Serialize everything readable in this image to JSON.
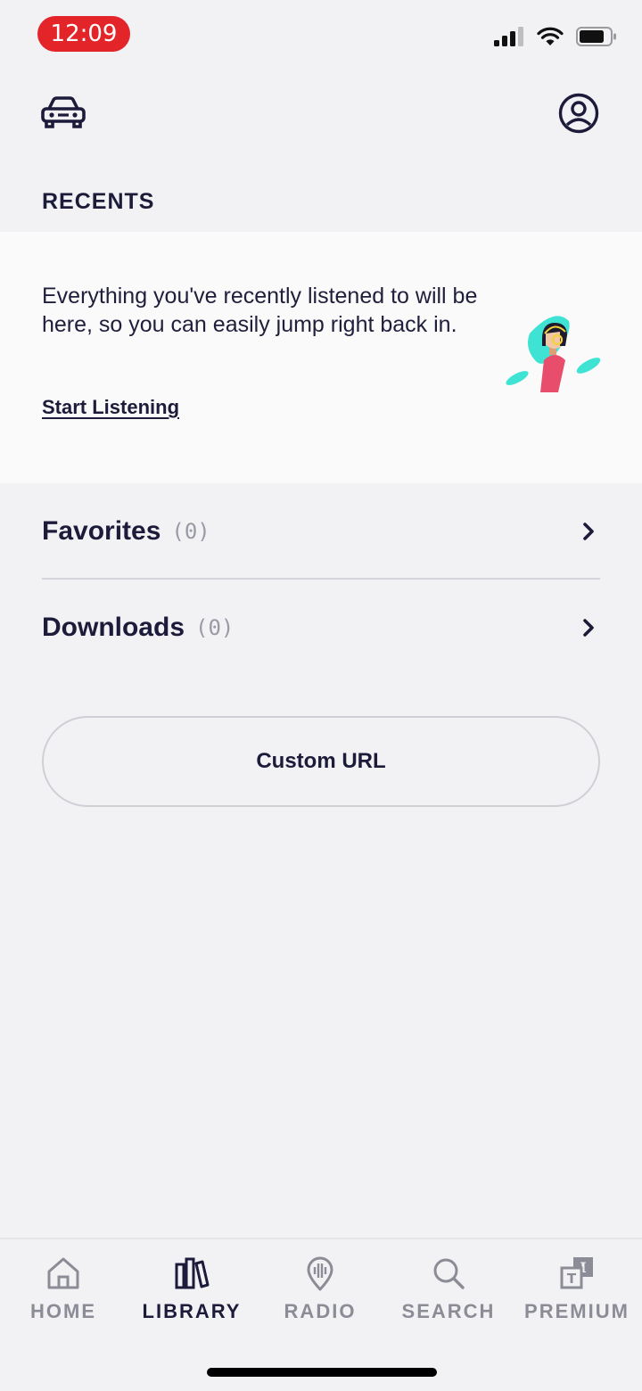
{
  "status_bar": {
    "time": "12:09",
    "time_pill_color": "#e3252a"
  },
  "header": {
    "car_icon": "car-icon",
    "profile_icon": "profile-icon"
  },
  "recents": {
    "title": "RECENTS",
    "message": "Everything you've recently listened to will be here, so you can easily jump right back in.",
    "cta": "Start Listening"
  },
  "library_rows": [
    {
      "label": "Favorites",
      "count": "(0)"
    },
    {
      "label": "Downloads",
      "count": "(0)"
    }
  ],
  "custom_url_label": "Custom URL",
  "tabs": [
    {
      "label": "HOME",
      "icon": "home-icon",
      "active": false
    },
    {
      "label": "LIBRARY",
      "icon": "library-icon",
      "active": true
    },
    {
      "label": "RADIO",
      "icon": "radio-icon",
      "active": false
    },
    {
      "label": "SEARCH",
      "icon": "search-icon",
      "active": false
    },
    {
      "label": "PREMIUM",
      "icon": "premium-icon",
      "active": false
    }
  ],
  "colors": {
    "primary": "#1c1b3a",
    "inactive": "#8c8c96",
    "background": "#f2f2f5",
    "accent": "#e3252a"
  }
}
